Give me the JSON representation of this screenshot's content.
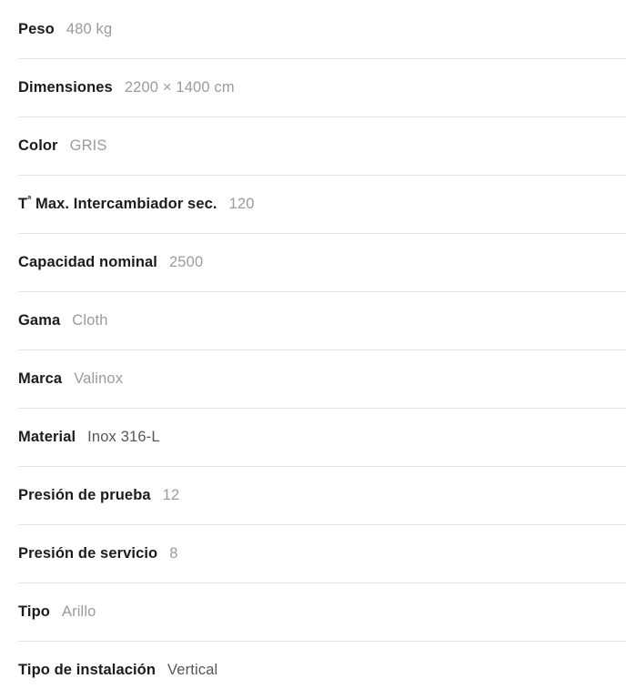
{
  "specs": {
    "divider_color": "#e3e3e3",
    "label_color": "#1c1c1c",
    "value_color": "#9b9b9b",
    "value_color_dark": "#565656",
    "rows": [
      {
        "label": "Peso",
        "value": "480 kg",
        "emphasis": "light"
      },
      {
        "label": "Dimensiones",
        "value": "2200 × 1400 cm",
        "emphasis": "light"
      },
      {
        "label": "Color",
        "value": "GRIS",
        "emphasis": "light"
      },
      {
        "label": "Tª Max. Intercambiador sec.",
        "label_base": "T",
        "label_sup": "ª",
        "label_rest": " Max. Intercambiador sec.",
        "value": "120",
        "emphasis": "light"
      },
      {
        "label": "Capacidad nominal",
        "value": "2500",
        "emphasis": "light"
      },
      {
        "label": "Gama",
        "value": "Cloth",
        "emphasis": "light"
      },
      {
        "label": "Marca",
        "value": "Valinox",
        "emphasis": "light"
      },
      {
        "label": "Material",
        "value": "Inox 316-L",
        "emphasis": "dark"
      },
      {
        "label": "Presión de prueba",
        "value": "12",
        "emphasis": "light"
      },
      {
        "label": "Presión de servicio",
        "value": "8",
        "emphasis": "light"
      },
      {
        "label": "Tipo",
        "value": "Arillo",
        "emphasis": "light"
      },
      {
        "label": "Tipo de instalación",
        "value": "Vertical",
        "emphasis": "dark"
      }
    ]
  }
}
